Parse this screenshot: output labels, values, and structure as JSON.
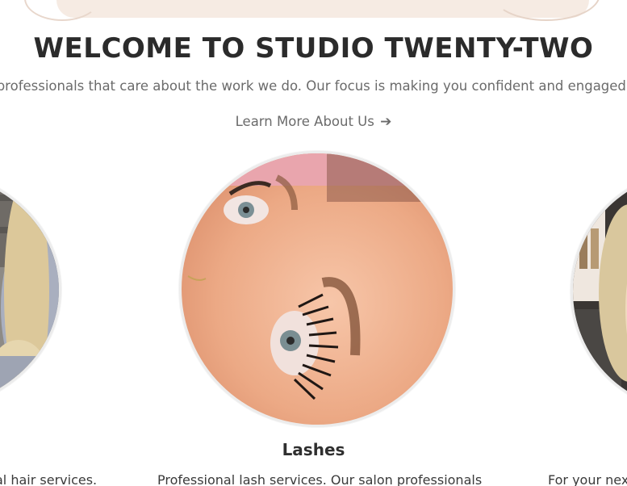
{
  "header": {
    "title": "WELCOME TO STUDIO TWENTY-TWO",
    "intro": "n professionals that care about the work we do. Our focus is making you confident and engaged w",
    "learn_more_label": "Learn More About Us",
    "learn_more_icon": "arrow-right-icon"
  },
  "services": [
    {
      "title": "",
      "description": "al hair services.",
      "image": "hair-photo"
    },
    {
      "title": "Lashes",
      "description": "Professional lash services. Our salon professionals",
      "image": "lashes-photo"
    },
    {
      "title": "",
      "description": "For your nex",
      "image": "salon-photo"
    }
  ],
  "colors": {
    "heading": "#2b2b2b",
    "muted_text": "#6b6b6b",
    "banner": "#f6ebe3",
    "circle_border": "#ececec"
  }
}
